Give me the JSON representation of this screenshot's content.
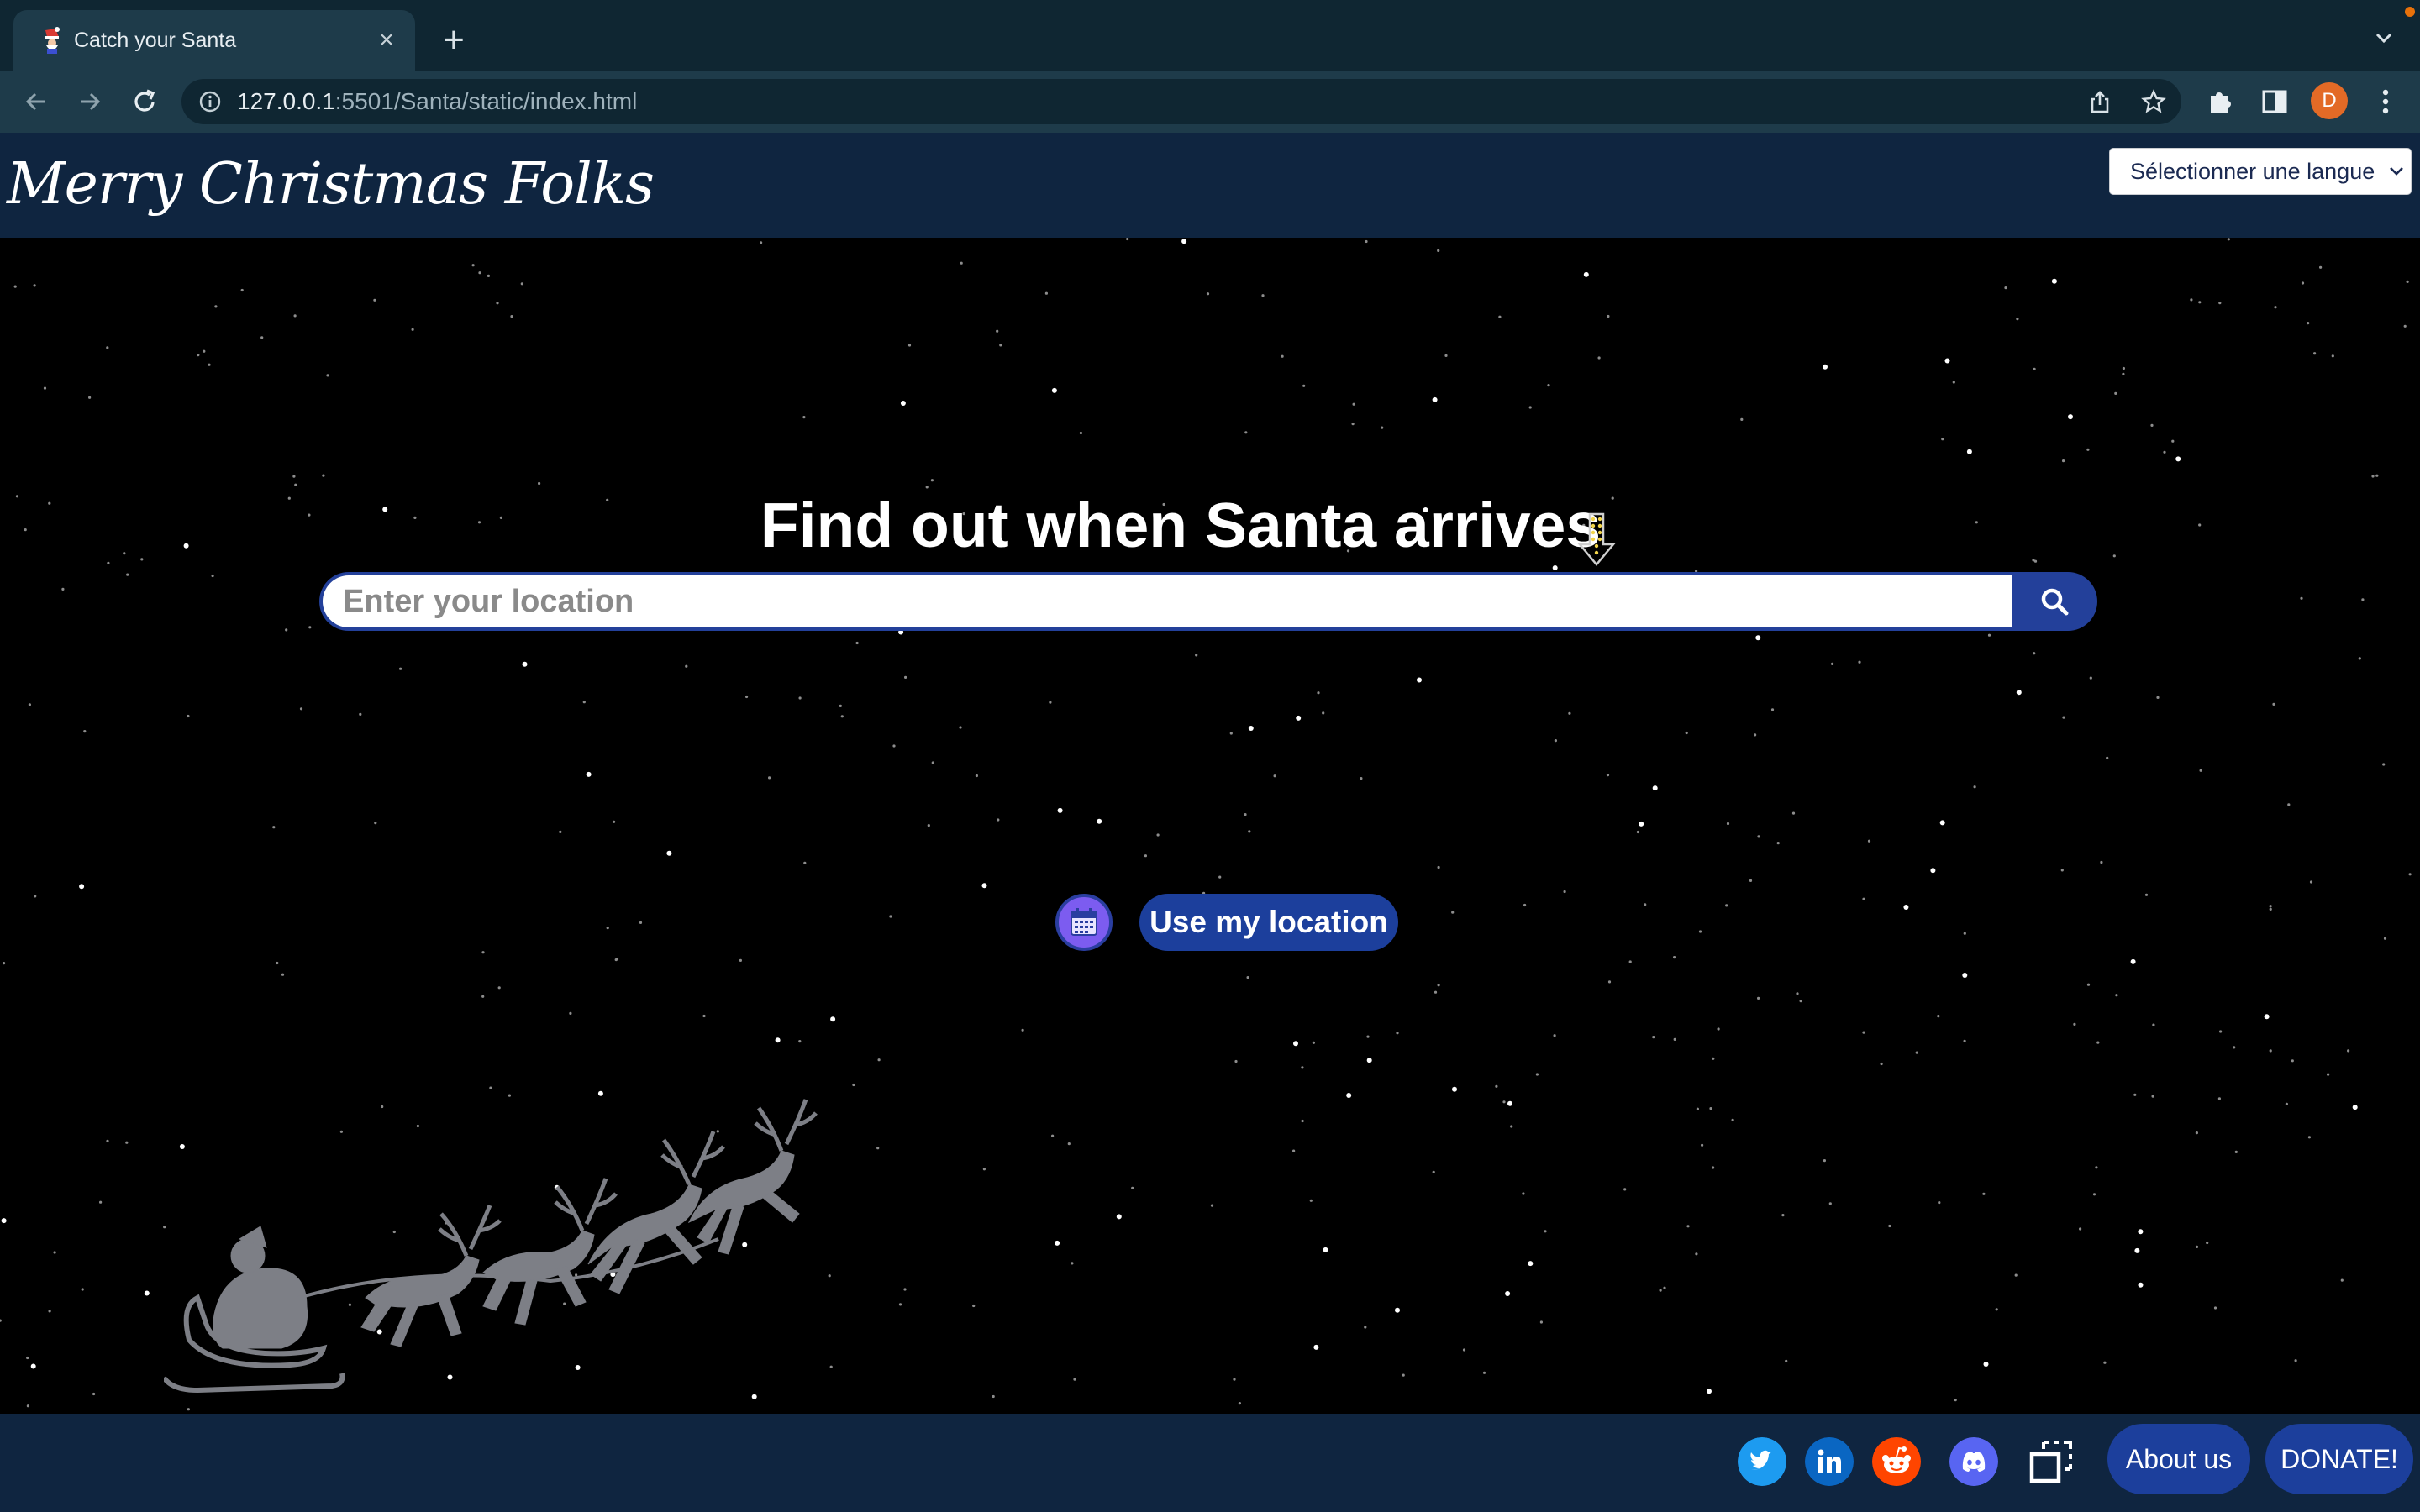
{
  "browser": {
    "tab_title": "Catch your Santa",
    "tab_close": "×",
    "new_tab": "+",
    "url_host": "127.0.0.1",
    "url_rest": ":5501/Santa/static/index.html",
    "profile_initial": "D"
  },
  "header": {
    "brand": "Merry Christmas Folks",
    "language_select": "Sélectionner une langue"
  },
  "hero": {
    "headline": "Find out when Santa arrives",
    "search_placeholder": "Enter your location",
    "use_location_label": "Use my location"
  },
  "footer": {
    "social": [
      "twitter-icon",
      "linkedin-icon",
      "reddit-icon",
      "discord-icon"
    ],
    "about_label": "About us",
    "donate_label": "DONATE!"
  },
  "colors": {
    "chrome_dark": "#0f2632",
    "chrome_toolbar": "#1e3b4a",
    "header_bg": "#0f2540",
    "accent_blue": "#1c3f9c",
    "twitter": "#1d9bf0",
    "linkedin": "#0a66c2",
    "reddit": "#ff4500",
    "discord": "#5865f2"
  }
}
